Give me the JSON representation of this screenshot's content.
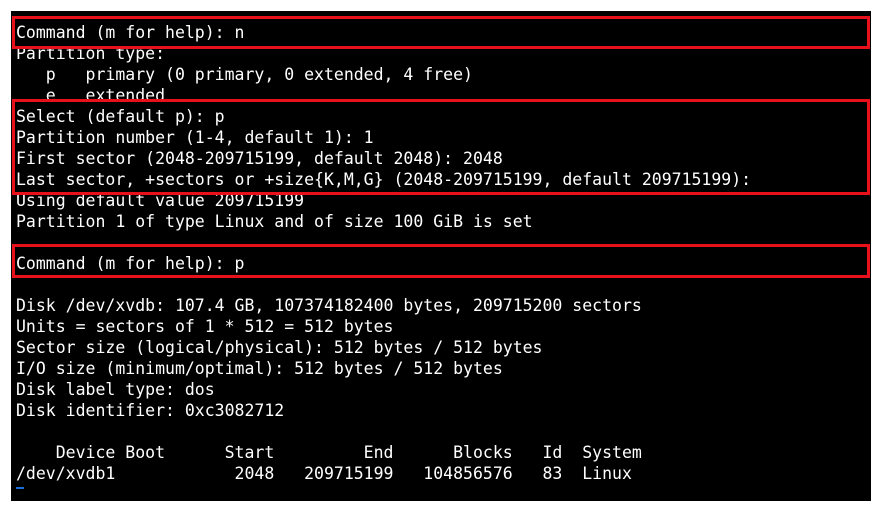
{
  "terminal": {
    "lines": [
      "Command (m for help): n",
      "Partition type:",
      "   p   primary (0 primary, 0 extended, 4 free)",
      "   e   extended",
      "Select (default p): p",
      "Partition number (1-4, default 1): 1",
      "First sector (2048-209715199, default 2048): 2048",
      "Last sector, +sectors or +size{K,M,G} (2048-209715199, default 209715199):",
      "Using default value 209715199",
      "Partition 1 of type Linux and of size 100 GiB is set",
      "",
      "Command (m for help): p",
      "",
      "Disk /dev/xvdb: 107.4 GB, 107374182400 bytes, 209715200 sectors",
      "Units = sectors of 1 * 512 = 512 bytes",
      "Sector size (logical/physical): 512 bytes / 512 bytes",
      "I/O size (minimum/optimal): 512 bytes / 512 bytes",
      "Disk label type: dos",
      "Disk identifier: 0xc3082712",
      "",
      "    Device Boot      Start         End      Blocks   Id  System",
      "/dev/xvdb1            2048   209715199   104856576   83  Linux"
    ]
  },
  "colors": {
    "background": "#000000",
    "text": "#ffffff",
    "highlight": "#e8101a",
    "cursor": "#1a6ed8"
  }
}
